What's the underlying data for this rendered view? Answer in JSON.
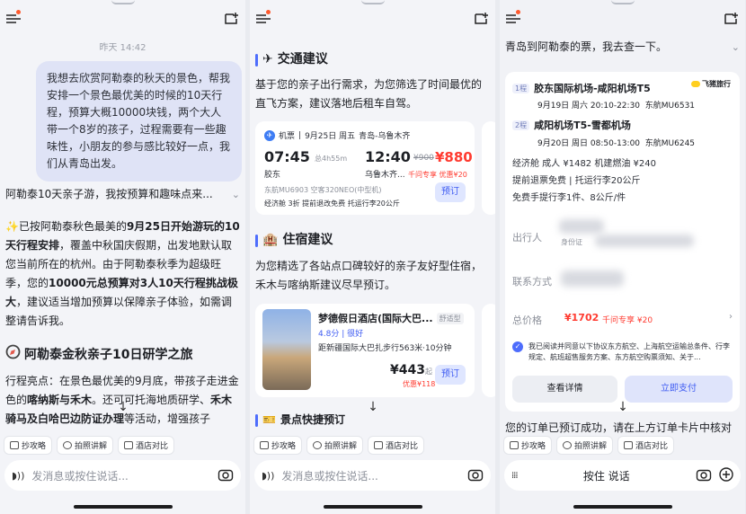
{
  "panel1": {
    "timestamp": "昨天 14:42",
    "user_message": "我想去欣赏阿勒泰的秋天的景色，帮我安排一个景色最优美的时候的10天行程，预算大概10000块钱，两个大人带一个8岁的孩子，过程需要有一些趣味性，小朋友的参与感比较好一点，我们从青岛出发。",
    "summary": "阿勒泰10天亲子游，我按预算和趣味点来...",
    "answer_1a": "✨已按阿勒泰秋色最美的",
    "answer_1b": "9月25日开始游玩的10天行程安排",
    "answer_1c": "，覆盖中秋国庆假期，出发地默认取您当前所在的杭州。由于阿勒泰秋季为超级旺季，您的",
    "answer_1d": "10000元总预算对3人10天行程挑战极大",
    "answer_1e": "，建议适当增加预算以保障亲子体验，如需调整请告诉我。",
    "guide_title": "阿勒泰金秋亲子10日研学之旅",
    "highlights_a": "行程亮点：在景色最优美的9月底，带孩子走进金色的",
    "highlights_b": "喀纳斯与禾木",
    "highlights_c": "。还可可托海地质研学、",
    "highlights_d": "禾木骑马及白哈巴边防证办理",
    "highlights_e": "等活动，增强孩子"
  },
  "panel2": {
    "transport_title": "交通建议",
    "transport_desc": "基于您的亲子出行需求，为您筛选了时间最优的直飞方案，建议落地后租车自驾。",
    "flight": {
      "tag": "机票",
      "date": "9月25日 周五",
      "route": "青岛-乌鲁木齐",
      "dep_time": "07:45",
      "duration": "总4h55m",
      "arr_time": "12:40",
      "dep_airport": "胶东",
      "arr_airport": "乌鲁木齐...",
      "orig_price": "¥900",
      "price": "¥880",
      "promo": "千问专享",
      "discount": "优惠¥20",
      "airline": "东航MU6903 空客320NEO(中型机)",
      "cabin": "经济舱 3折 提前退改免费 托运行李20公斤",
      "book": "预订"
    },
    "hotel_title": "住宿建议",
    "hotel_desc": "为您精选了各站点口碑较好的亲子友好型住宿，禾木与喀纳斯建议尽早预订。",
    "hotel": {
      "name": "梦德假日酒店(国际大巴...",
      "type": "舒适型",
      "rating": "4.8分",
      "rating_word": "很好",
      "location": "距新疆国际大巴扎步行563米·10分钟",
      "price": "¥443",
      "price_unit": "起",
      "discount": "优惠¥118",
      "book": "预订"
    },
    "spot_title": "景点快捷预订"
  },
  "panel3": {
    "intro": "青岛到阿勒泰的票，我去查一下。",
    "badge": "飞猪旅行",
    "leg1_tag": "1程",
    "leg1_route": "胶东国际机场-咸阳机场T5",
    "leg1_time": "9月19日 周六 20:10-22:30",
    "leg1_flight": "东航MU6531",
    "leg2_tag": "2程",
    "leg2_route": "咸阳机场T5-雪都机场",
    "leg2_time": "9月20日 周日 08:50-13:00",
    "leg2_flight": "东航MU6245",
    "fare_line": "经济舱   成人 ¥1482  机建燃油 ¥240",
    "rule_line1": "提前退票免费 | 托运行李20公斤",
    "rule_line2": "免费手提行李1件、8公斤/件",
    "passenger_label": "出行人",
    "id_label": "身份证",
    "contact_label": "联系方式",
    "total_label": "总价格",
    "total_price": "¥1702",
    "total_promo": "千问专享 ¥20",
    "agree_text": "我已阅读并同意以下协议东方航空、上海航空运输总条件、行李规定、航班超售服务方案、东方航空购票须知、关于...",
    "btn_detail": "查看详情",
    "btn_pay": "立即支付",
    "trail": "您的订单已预订成功，请在上方订单卡片中核对"
  },
  "chips": [
    "抄攻略",
    "拍照讲解",
    "酒店对比"
  ],
  "input_placeholder": "发消息或按住说话...",
  "hold_to_talk": "按住 说话",
  "colors": {
    "accent": "#4e6dfc",
    "price_red": "#ff3b30",
    "dot": "#ff5a2e"
  }
}
